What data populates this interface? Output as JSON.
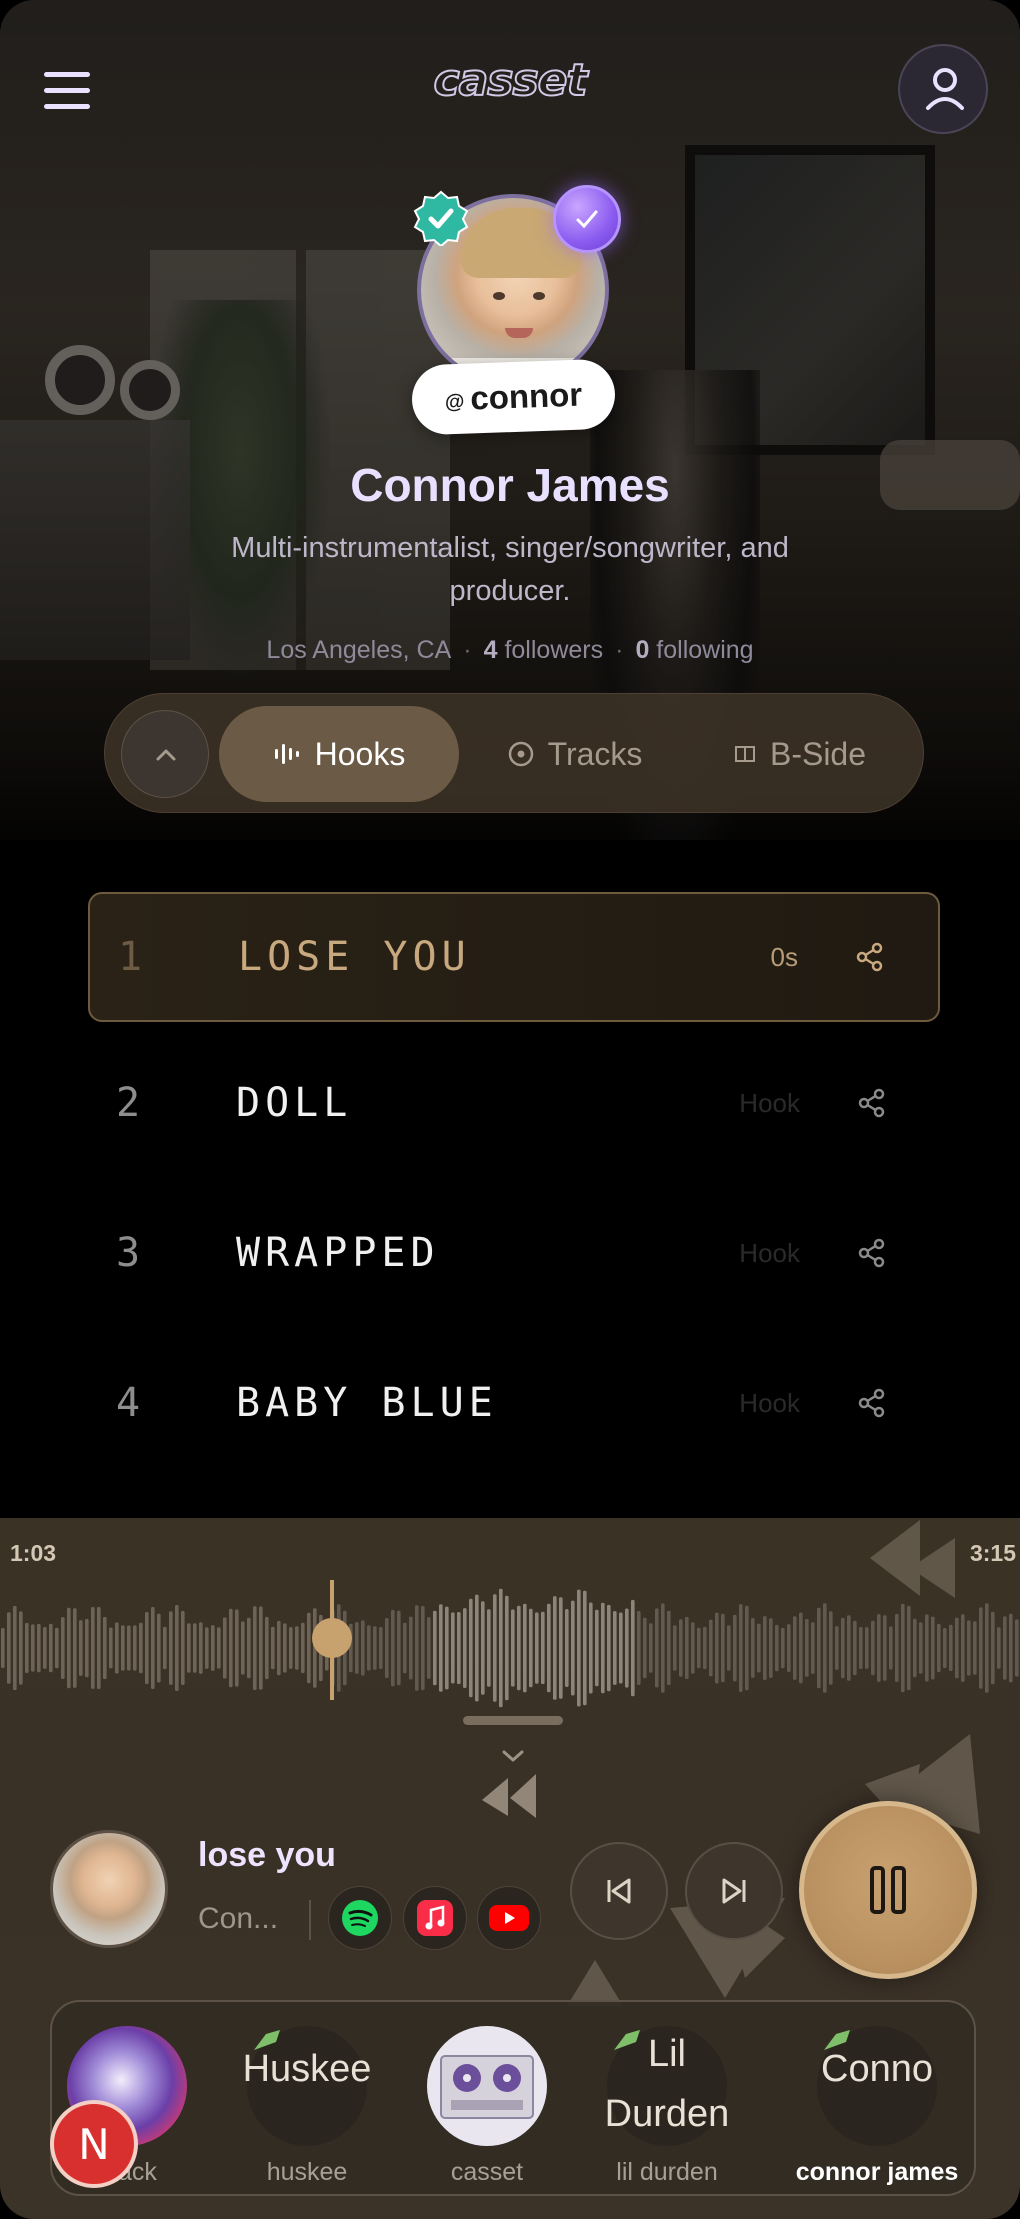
{
  "header": {
    "logo_text": "casset",
    "menu_icon": "hamburger-menu-icon",
    "account_icon": "user-icon"
  },
  "profile": {
    "handle_prefix": "@",
    "handle": "connor",
    "name": "Connor James",
    "bio": "Multi-instrumentalist, singer/songwriter, and producer.",
    "location": "Los Angeles, CA",
    "followers_count": "4",
    "followers_label": "followers",
    "following_count": "0",
    "following_label": "following"
  },
  "tabs": [
    {
      "label": "Hooks",
      "icon": "waveform-icon",
      "active": true
    },
    {
      "label": "Tracks",
      "icon": "disc-icon",
      "active": false
    },
    {
      "label": "B-Side",
      "icon": "cassette-icon",
      "active": false
    }
  ],
  "tracks": [
    {
      "num": "1",
      "title": "LOSE YOU",
      "meta": "0s",
      "active": true
    },
    {
      "num": "2",
      "title": "DOLL",
      "meta": "Hook",
      "active": false
    },
    {
      "num": "3",
      "title": "WRAPPED",
      "meta": "Hook",
      "active": false
    },
    {
      "num": "4",
      "title": "BABY BLUE",
      "meta": "Hook",
      "active": false
    }
  ],
  "player": {
    "elapsed": "1:03",
    "duration": "3:15",
    "progress": 0.323,
    "title": "lose you",
    "artist": "Con..."
  },
  "artists": [
    {
      "label": "mack",
      "broken_alt": "",
      "active": false
    },
    {
      "label": "huskee",
      "broken_alt": "Huskee",
      "active": false
    },
    {
      "label": "casset",
      "broken_alt": "",
      "active": false
    },
    {
      "label": "lil durden",
      "broken_alt": "Lil Durden",
      "active": false
    },
    {
      "label": "connor james",
      "broken_alt": "Conno",
      "active": true
    }
  ],
  "notification_badge": "N",
  "colors": {
    "accent_gold": "#c7a26f",
    "active_track_title": "#c8a97f",
    "name_lavender": "#e7e1ff",
    "spotify_green": "#1ed760",
    "apple_music_red": "#fa2d48",
    "youtube_red": "#ff0000"
  }
}
